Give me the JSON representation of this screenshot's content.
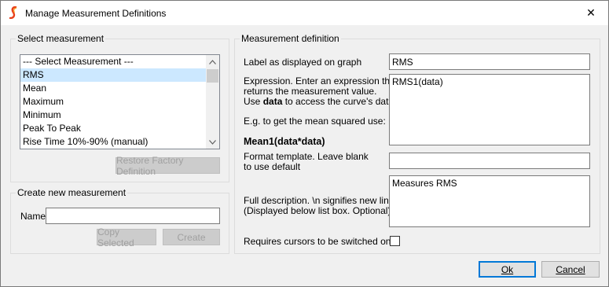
{
  "window": {
    "title": "Manage Measurement Definitions",
    "close_glyph": "✕"
  },
  "select_group": {
    "title": "Select measurement",
    "items": [
      "--- Select Measurement ---",
      "RMS",
      "Mean",
      "Maximum",
      "Minimum",
      "Peak To Peak",
      "Rise Time 10%-90% (manual)"
    ],
    "selected_index": 1,
    "restore_label": "Restore Factory Definition"
  },
  "create_group": {
    "title": "Create new measurement",
    "name_label": "Name",
    "name_value": "",
    "copy_label": "Copy Selected",
    "create_label": "Create"
  },
  "definition_group": {
    "title": "Measurement definition",
    "graph_label": "Label as displayed on graph",
    "graph_value": "RMS",
    "expr_line1": "Expression. Enter an expression that",
    "expr_line2": "returns the measurement value.",
    "expr_line3_pre": "Use ",
    "expr_line3_bold": "data",
    "expr_line3_post": " to access the curve's data.",
    "expr_example": "E.g. to get the mean squared use:",
    "expr_example_code": "Mean1(data*data)",
    "expr_value": "RMS1(data)",
    "format_line1": "Format template. Leave blank",
    "format_line2": "to use default",
    "format_value": "",
    "desc_line1": "Full description.  \\n signifies new line",
    "desc_line2": "(Displayed below list box. Optional)",
    "desc_value": "Measures RMS",
    "cursors_label": "Requires cursors to be switched on",
    "cursors_checked": false
  },
  "footer": {
    "ok_label": "Ok",
    "cancel_label": "Cancel"
  }
}
